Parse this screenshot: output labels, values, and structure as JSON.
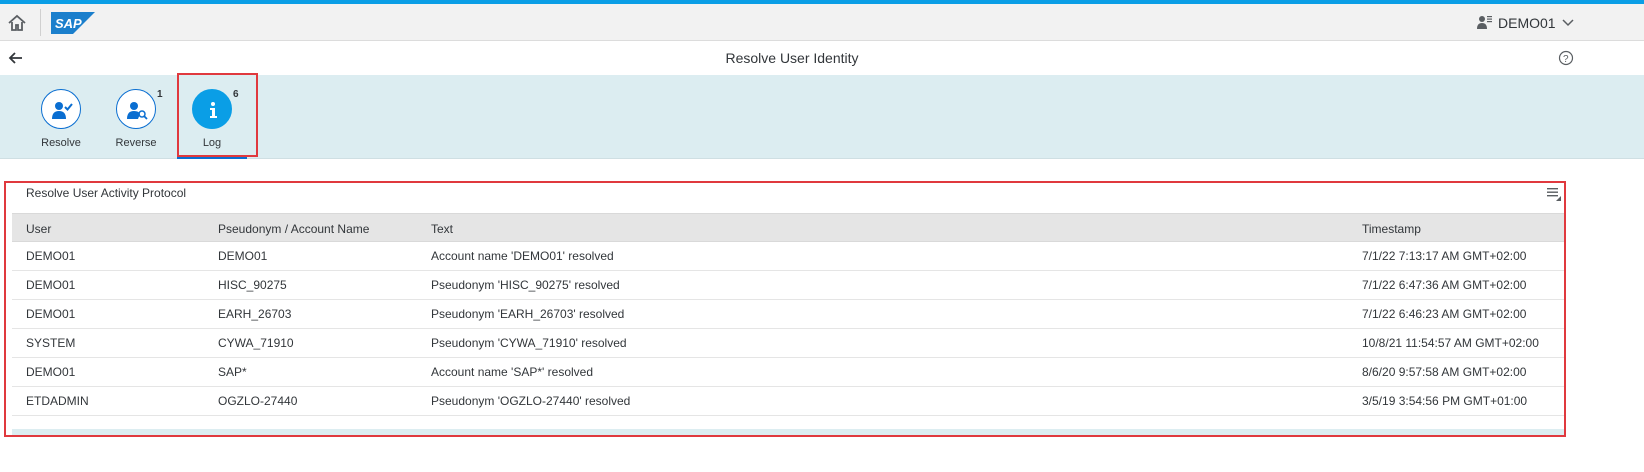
{
  "shell": {
    "logo_text": "SAP",
    "user_name": "DEMO01"
  },
  "titlebar": {
    "title": "Resolve User Identity"
  },
  "tabs": [
    {
      "label": "Resolve",
      "count": "",
      "icon": "user-check-icon"
    },
    {
      "label": "Reverse",
      "count": "1",
      "icon": "user-search-icon"
    },
    {
      "label": "Log",
      "count": "6",
      "icon": "info-icon",
      "selected": true
    }
  ],
  "table": {
    "title": "Resolve User Activity Protocol",
    "columns": [
      "User",
      "Pseudonym / Account Name",
      "Text",
      "Timestamp"
    ],
    "rows": [
      [
        "DEMO01",
        "DEMO01",
        "Account name 'DEMO01' resolved",
        "7/1/22 7:13:17 AM GMT+02:00"
      ],
      [
        "DEMO01",
        "HISC_90275",
        "Pseudonym 'HISC_90275' resolved",
        "7/1/22 6:47:36 AM GMT+02:00"
      ],
      [
        "DEMO01",
        "EARH_26703",
        "Pseudonym 'EARH_26703' resolved",
        "7/1/22 6:46:23 AM GMT+02:00"
      ],
      [
        "SYSTEM",
        "CYWA_71910",
        "Pseudonym 'CYWA_71910' resolved",
        "10/8/21 11:54:57 AM GMT+02:00"
      ],
      [
        "DEMO01",
        "SAP*",
        "Account name 'SAP*' resolved",
        "8/6/20 9:57:58 AM GMT+02:00"
      ],
      [
        "ETDADMIN",
        "OGZLO-27440",
        "Pseudonym 'OGZLO-27440' resolved",
        "3/5/19 3:54:56 PM GMT+01:00"
      ]
    ]
  },
  "colors": {
    "accent": "#0a6ed1",
    "shell_top": "#0a9ee6",
    "tab_bar_bg": "#dcedf1",
    "highlight": "#e0393e"
  }
}
